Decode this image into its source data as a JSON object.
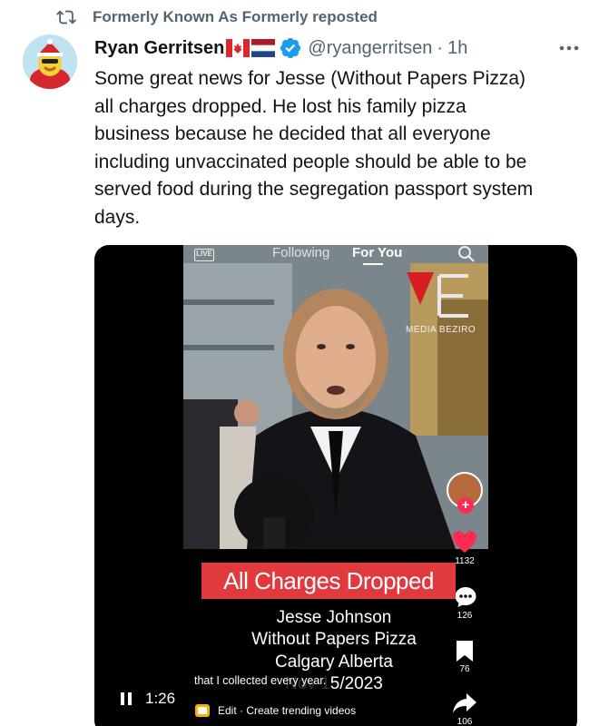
{
  "repost": {
    "icon": "repost-icon",
    "text": "Formerly Known As Formerly reposted"
  },
  "author": {
    "name": "Ryan Gerritsen",
    "flags": [
      "canada-flag",
      "netherlands-flag"
    ],
    "verified": true,
    "handle": "@ryangerritsen",
    "separator": "·",
    "time": "1h"
  },
  "tweet": {
    "text": "Some great news for Jesse  (Without Papers Pizza)\nall charges dropped. He lost his family pizza\nbusiness because he decided that all everyone\nincluding unvaccinated people should be able to be\nserved food during the segregation passport system\ndays."
  },
  "video": {
    "live_label": "LIVE",
    "tab_following": "Following",
    "tab_foryou": "For You",
    "watermark": "MEDIA BEZIRO",
    "banner": "All Charges Dropped",
    "caption_lines": [
      "Jesse Johnson",
      "Without Papers Pizza",
      "Calgary Alberta",
      "Nov 15/2023"
    ],
    "subtitle": "that I collected every year.",
    "likes": "1132",
    "comments": "126",
    "bookmarks": "76",
    "shares": "106",
    "duration": "1:26",
    "edit_text": "Edit · Create trending videos"
  },
  "colors": {
    "muted": "#536471",
    "verified": "#1d9bf0",
    "banner": "#e03a3e",
    "like": "#fe2c55"
  }
}
